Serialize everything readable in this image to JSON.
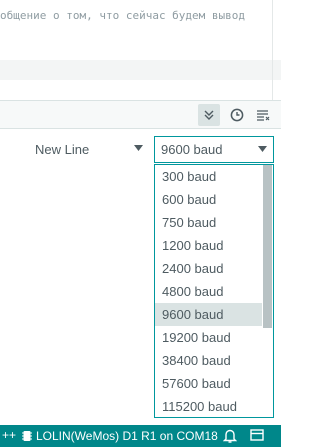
{
  "editor": {
    "line1": "общение о том, что сейчас будем вывод"
  },
  "serial_monitor": {
    "toolbar": {
      "toggle_icon": "chevrons-down-icon",
      "timestamp_icon": "clock-icon",
      "clear_icon": "clear-output-icon"
    },
    "line_ending": {
      "selected": "New Line"
    },
    "baud": {
      "selected": "9600 baud",
      "options": [
        "300 baud",
        "600 baud",
        "750 baud",
        "1200 baud",
        "2400 baud",
        "4800 baud",
        "9600 baud",
        "19200 baud",
        "38400 baud",
        "57600 baud",
        "115200 baud"
      ],
      "highlighted": "9600 baud"
    }
  },
  "status_bar": {
    "left_text": "++",
    "board": "LOLIN(WeMos) D1 R1 on COM18",
    "accent": "#00878a"
  }
}
